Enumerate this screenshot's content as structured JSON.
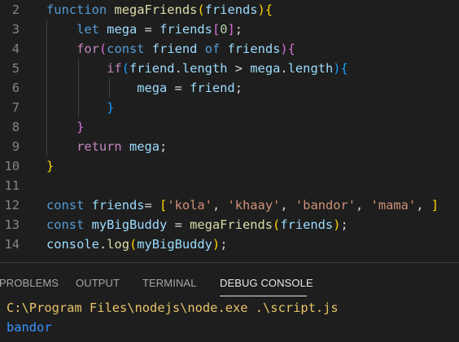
{
  "colors": {
    "keyword": "#569cd6",
    "control": "#c586c0",
    "function": "#dcdcaa",
    "variable": "#9cdcfe",
    "string": "#ce9178",
    "number": "#b5cea8",
    "text": "#d4d4d4",
    "bracket_gold": "#ffd700",
    "bracket_purple": "#da70d6",
    "bracket_blue": "#179fff",
    "line_number": "#858585",
    "output_path": "#e9c46a",
    "output_result": "#3794ff"
  },
  "code_lines": [
    {
      "line": "2",
      "tokens": [
        {
          "t": "function",
          "c": "keyword"
        },
        {
          "t": " ",
          "c": "text"
        },
        {
          "t": "megaFriends",
          "c": "function"
        },
        {
          "t": "(",
          "c": "bracket_gold"
        },
        {
          "t": "friends",
          "c": "variable"
        },
        {
          "t": ")",
          "c": "bracket_gold"
        },
        {
          "t": "{",
          "c": "bracket_gold"
        }
      ]
    },
    {
      "line": "3",
      "tokens": [
        {
          "t": "    ",
          "c": "text"
        },
        {
          "t": "let",
          "c": "keyword"
        },
        {
          "t": " ",
          "c": "text"
        },
        {
          "t": "mega",
          "c": "variable"
        },
        {
          "t": " = ",
          "c": "text"
        },
        {
          "t": "friends",
          "c": "variable"
        },
        {
          "t": "[",
          "c": "bracket_purple"
        },
        {
          "t": "0",
          "c": "number"
        },
        {
          "t": "]",
          "c": "bracket_purple"
        },
        {
          "t": ";",
          "c": "text"
        }
      ]
    },
    {
      "line": "4",
      "tokens": [
        {
          "t": "    ",
          "c": "text"
        },
        {
          "t": "for",
          "c": "control"
        },
        {
          "t": "(",
          "c": "bracket_purple"
        },
        {
          "t": "const",
          "c": "keyword"
        },
        {
          "t": " ",
          "c": "text"
        },
        {
          "t": "friend",
          "c": "variable"
        },
        {
          "t": " ",
          "c": "text"
        },
        {
          "t": "of",
          "c": "keyword"
        },
        {
          "t": " ",
          "c": "text"
        },
        {
          "t": "friends",
          "c": "variable"
        },
        {
          "t": ")",
          "c": "bracket_purple"
        },
        {
          "t": "{",
          "c": "bracket_purple"
        }
      ]
    },
    {
      "line": "5",
      "tokens": [
        {
          "t": "        ",
          "c": "text"
        },
        {
          "t": "if",
          "c": "control"
        },
        {
          "t": "(",
          "c": "bracket_blue"
        },
        {
          "t": "friend",
          "c": "variable"
        },
        {
          "t": ".",
          "c": "text"
        },
        {
          "t": "length",
          "c": "variable"
        },
        {
          "t": " > ",
          "c": "text"
        },
        {
          "t": "mega",
          "c": "variable"
        },
        {
          "t": ".",
          "c": "text"
        },
        {
          "t": "length",
          "c": "variable"
        },
        {
          "t": ")",
          "c": "bracket_blue"
        },
        {
          "t": "{",
          "c": "bracket_blue"
        }
      ]
    },
    {
      "line": "6",
      "tokens": [
        {
          "t": "            ",
          "c": "text"
        },
        {
          "t": "mega",
          "c": "variable"
        },
        {
          "t": " = ",
          "c": "text"
        },
        {
          "t": "friend",
          "c": "variable"
        },
        {
          "t": ";",
          "c": "text"
        }
      ]
    },
    {
      "line": "7",
      "tokens": [
        {
          "t": "        ",
          "c": "text"
        },
        {
          "t": "}",
          "c": "bracket_blue"
        }
      ]
    },
    {
      "line": "8",
      "tokens": [
        {
          "t": "    ",
          "c": "text"
        },
        {
          "t": "}",
          "c": "bracket_purple"
        }
      ]
    },
    {
      "line": "9",
      "tokens": [
        {
          "t": "    ",
          "c": "text"
        },
        {
          "t": "return",
          "c": "control"
        },
        {
          "t": " ",
          "c": "text"
        },
        {
          "t": "mega",
          "c": "variable"
        },
        {
          "t": ";",
          "c": "text"
        }
      ]
    },
    {
      "line": "10",
      "tokens": [
        {
          "t": "}",
          "c": "bracket_gold"
        }
      ]
    },
    {
      "line": "11",
      "tokens": []
    },
    {
      "line": "12",
      "tokens": [
        {
          "t": "const",
          "c": "keyword"
        },
        {
          "t": " ",
          "c": "text"
        },
        {
          "t": "friends",
          "c": "variable"
        },
        {
          "t": "= ",
          "c": "text"
        },
        {
          "t": "[",
          "c": "bracket_gold"
        },
        {
          "t": "'kola'",
          "c": "string"
        },
        {
          "t": ", ",
          "c": "text"
        },
        {
          "t": "'khaay'",
          "c": "string"
        },
        {
          "t": ", ",
          "c": "text"
        },
        {
          "t": "'bandor'",
          "c": "string"
        },
        {
          "t": ", ",
          "c": "text"
        },
        {
          "t": "'mama'",
          "c": "string"
        },
        {
          "t": ", ",
          "c": "text"
        },
        {
          "t": "]",
          "c": "bracket_gold"
        }
      ]
    },
    {
      "line": "13",
      "tokens": [
        {
          "t": "const",
          "c": "keyword"
        },
        {
          "t": " ",
          "c": "text"
        },
        {
          "t": "myBigBuddy",
          "c": "variable"
        },
        {
          "t": " = ",
          "c": "text"
        },
        {
          "t": "megaFriends",
          "c": "function"
        },
        {
          "t": "(",
          "c": "bracket_gold"
        },
        {
          "t": "friends",
          "c": "variable"
        },
        {
          "t": ")",
          "c": "bracket_gold"
        },
        {
          "t": ";",
          "c": "text"
        }
      ]
    },
    {
      "line": "14",
      "tokens": [
        {
          "t": "console",
          "c": "variable"
        },
        {
          "t": ".",
          "c": "text"
        },
        {
          "t": "log",
          "c": "function"
        },
        {
          "t": "(",
          "c": "bracket_gold"
        },
        {
          "t": "myBigBuddy",
          "c": "variable"
        },
        {
          "t": ")",
          "c": "bracket_gold"
        },
        {
          "t": ";",
          "c": "text"
        }
      ]
    }
  ],
  "panel": {
    "tabs": [
      {
        "label": "PROBLEMS",
        "active": false
      },
      {
        "label": "OUTPUT",
        "active": false
      },
      {
        "label": "TERMINAL",
        "active": false
      },
      {
        "label": "DEBUG CONSOLE",
        "active": true
      }
    ],
    "output": {
      "command": "C:\\Program Files\\nodejs\\node.exe .\\script.js",
      "result": "bandor"
    }
  }
}
